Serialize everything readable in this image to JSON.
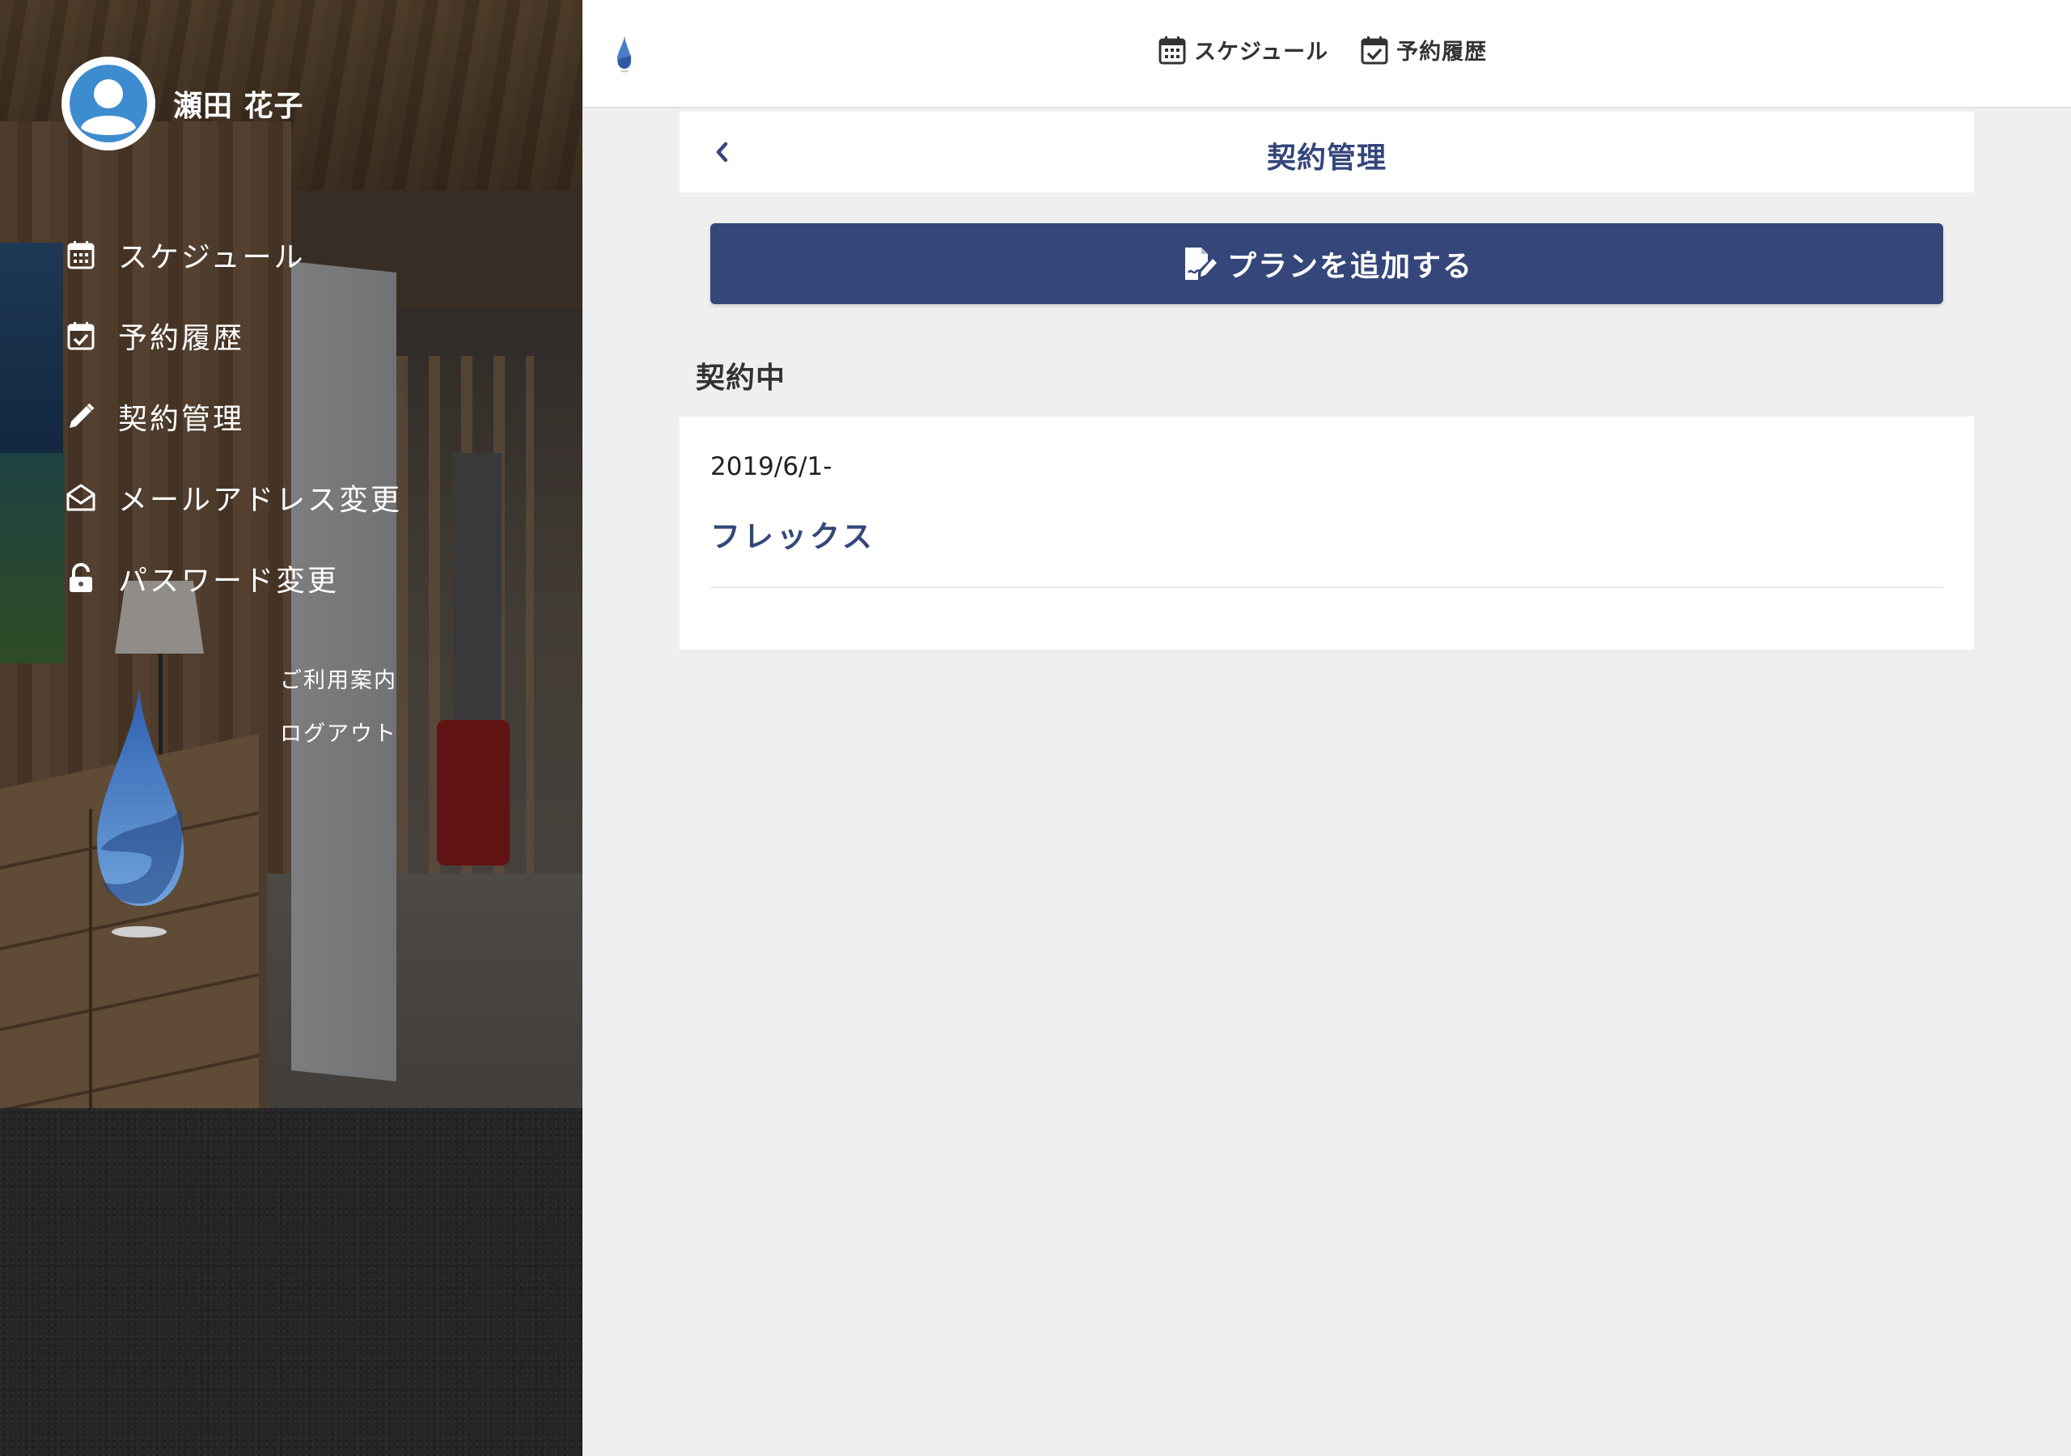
{
  "user": {
    "name": "瀬田 花子"
  },
  "sidebar": {
    "items": [
      {
        "label": "スケジュール",
        "icon": "calendar-icon"
      },
      {
        "label": "予約履歴",
        "icon": "calendar-check-icon"
      },
      {
        "label": "契約管理",
        "icon": "pencil-icon"
      },
      {
        "label": "メールアドレス変更",
        "icon": "envelope-open-icon"
      },
      {
        "label": "パスワード変更",
        "icon": "unlock-icon"
      }
    ],
    "links": [
      {
        "label": "ご利用案内"
      },
      {
        "label": "ログアウト"
      }
    ]
  },
  "topbar": {
    "items": [
      {
        "label": "スケジュール",
        "icon": "calendar-icon"
      },
      {
        "label": "予約履歴",
        "icon": "calendar-check-icon"
      }
    ]
  },
  "page": {
    "title": "契約管理",
    "add_plan_label": "プランを追加する",
    "section_title": "契約中"
  },
  "contracts": [
    {
      "date": "2019/6/1-",
      "plan": "フレックス"
    }
  ],
  "colors": {
    "accent": "#35477a",
    "avatar": "#3e8cd0",
    "background": "#efefef"
  }
}
